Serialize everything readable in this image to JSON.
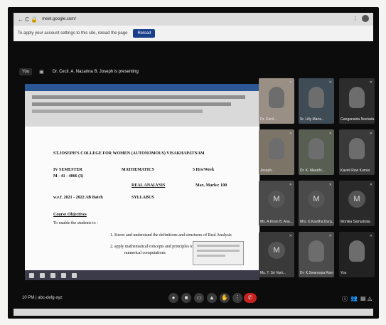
{
  "browser": {
    "url": "meet.google.com/",
    "nav_icons": "←  C  🔒",
    "infobar_text": "To apply your account settings to this site, reload the page",
    "infobar_button": "Reload"
  },
  "meet": {
    "self_chip": "You",
    "presenting_text": "Dr. Cecil. A. Nazarina B. Joseph is presenting"
  },
  "document": {
    "heading": "ST.JOSEPH'S COLLEGE FOR WOMEN (AUTONOMOUS) VISAKHAPATNAM",
    "semester": "IV SEMESTER",
    "subject": "MATHEMATICS",
    "hours": "5 Hrs/Week",
    "code": "M - 41 - 4066 (3)",
    "paper": "REAL ANALYSIS",
    "max_marks": "Max. Marks: 100",
    "year": "w.e.f. 2021 - 2022 AB Batch",
    "syllabus": "SYLLABUS",
    "objectives_title": "Course Objectives",
    "objectives_intro": "To enable the students to -",
    "point_1": "1.   Know and understand the definitions and structures of Real Analysis",
    "point_2a": "2.   apply mathematical concepts and principles to perform",
    "point_2b": "numerical computations"
  },
  "participants": [
    {
      "name": "Dr. Cecil...",
      "type": "video"
    },
    {
      "name": "Sr. Lilly Maria...",
      "type": "video"
    },
    {
      "name": "Ganganaidu Neelada",
      "type": "video"
    },
    {
      "name": "Joseph...",
      "type": "video"
    },
    {
      "name": "Dr. K. Maruthi...",
      "type": "video"
    },
    {
      "name": "Kaveti Ravi Kumar",
      "type": "video"
    },
    {
      "name": "Ms. A.Kiran B. Ana...",
      "type": "avatar",
      "initial": "M"
    },
    {
      "name": "Mrs. K.Kavitha Durg...",
      "type": "avatar",
      "initial": "M"
    },
    {
      "name": "Monika Samudrala",
      "type": "avatar",
      "initial": "M"
    },
    {
      "name": "Ms. T. Sri Vani...",
      "type": "avatar",
      "initial": "M"
    },
    {
      "name": "Dr. K.Swaroopa Rani",
      "type": "video"
    },
    {
      "name": "You",
      "type": "video"
    }
  ],
  "bottom_bar": {
    "time": "10 PM | abc-defg-xyz",
    "controls": [
      "mic",
      "camera",
      "captions",
      "present",
      "raise-hand",
      "more",
      "end-call"
    ],
    "right_controls": [
      "info",
      "people",
      "chat",
      "activities"
    ]
  },
  "colors": {
    "background": "#0c0c0c",
    "accent": "#1a3f8a",
    "end_call": "#c5221f"
  }
}
